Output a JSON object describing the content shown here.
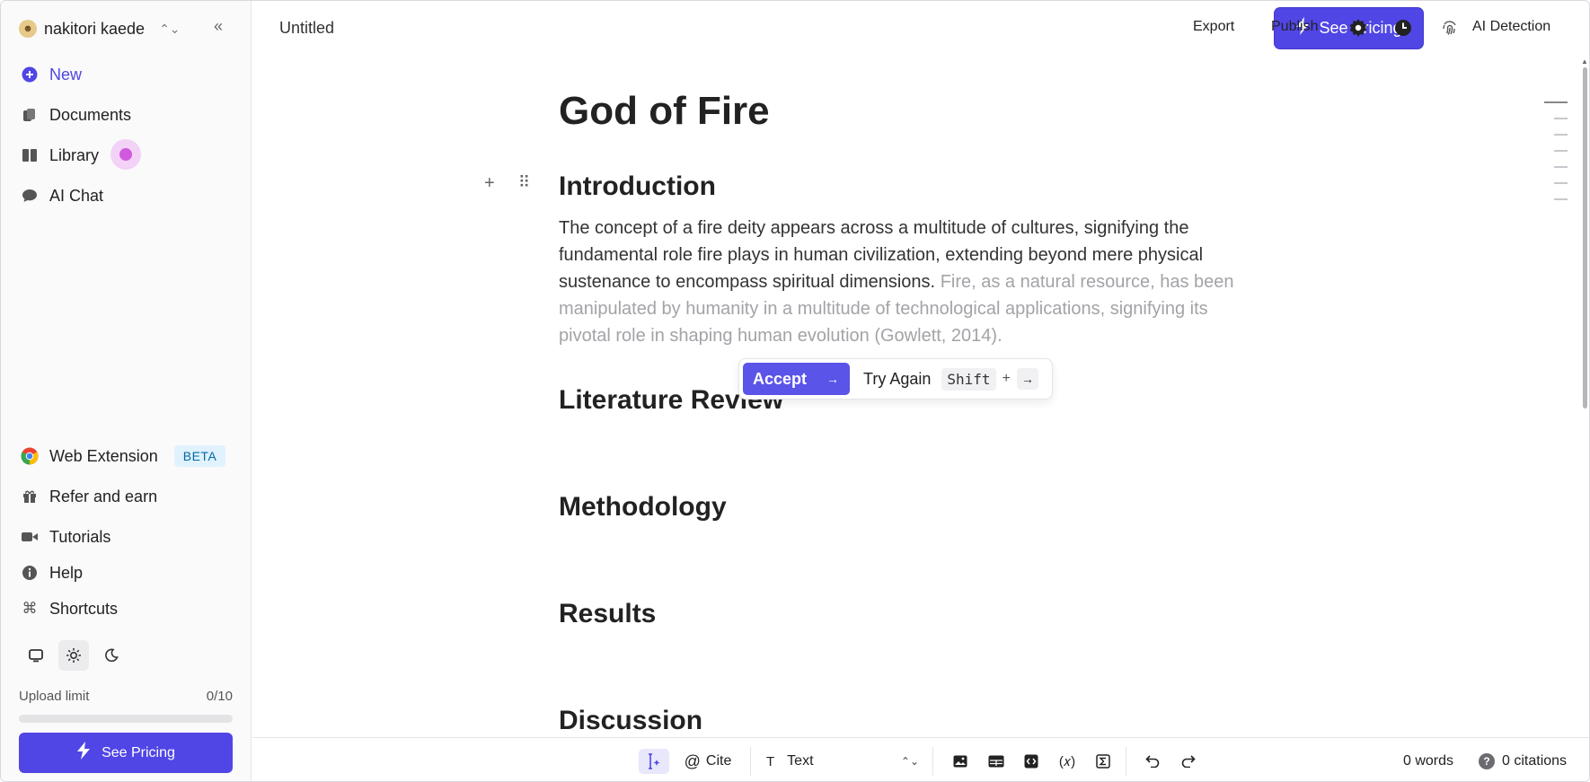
{
  "sidebar": {
    "user_name": "nakitori kaede",
    "nav": {
      "new": "New",
      "documents": "Documents",
      "library": "Library",
      "ai_chat": "AI Chat"
    },
    "bottom_nav": {
      "web_extension": "Web Extension",
      "beta_badge": "BETA",
      "refer": "Refer and earn",
      "tutorials": "Tutorials",
      "help": "Help",
      "shortcuts": "Shortcuts"
    },
    "upload": {
      "label": "Upload limit",
      "count": "0/10",
      "fraction": 0
    },
    "pricing_button": "See Pricing"
  },
  "header": {
    "doc_title": "Untitled",
    "see_pricing": "See Pricing",
    "export": "Export",
    "publish": "Publish",
    "ai_detection": "AI Detection"
  },
  "document": {
    "title": "God of Fire",
    "sections": {
      "introduction": "Introduction",
      "literature_review": "Literature Review",
      "methodology": "Methodology",
      "results": "Results",
      "discussion": "Discussion"
    },
    "intro_text": "The concept of a fire deity appears across a multitude of cultures, signifying the fundamental role fire plays in human civilization, extending beyond mere physical sustenance to encompass spiritual dimensions.",
    "intro_suggestion": "Fire, as a natural resource, has been manipulated by humanity in a multitude of technological applications, signifying its pivotal role in shaping human evolution (Gowlett, 2014)."
  },
  "suggestion_popup": {
    "accept": "Accept",
    "try_again": "Try Again",
    "shift_key": "Shift",
    "plus": "+"
  },
  "bottom_toolbar": {
    "cite": "Cite",
    "block_type": "Text",
    "word_count": "0 words",
    "citations": "0 citations"
  },
  "colors": {
    "accent": "#5046e5",
    "ghost_text": "#a3a3a8"
  }
}
